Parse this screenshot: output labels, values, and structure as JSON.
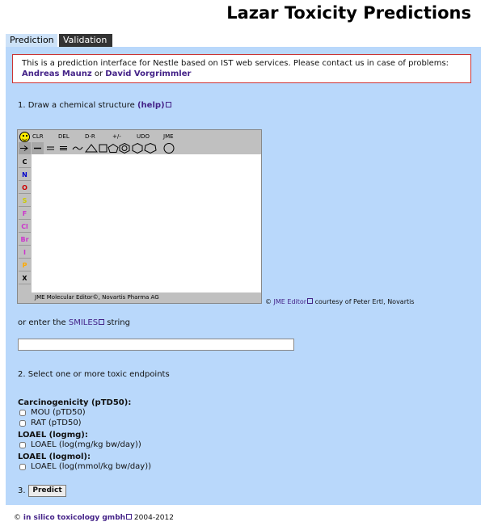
{
  "page_title": "Lazar Toxicity Predictions",
  "tabs": [
    {
      "label": "Prediction",
      "active": true
    },
    {
      "label": "Validation",
      "active": false
    }
  ],
  "info": {
    "text": "This is a prediction interface for Nestle based on IST web services. Please contact us in case of problems:",
    "contact1": "Andreas Maunz",
    "or": "or",
    "contact2": "David Vorgrimmler"
  },
  "step1": {
    "label": "1. Draw a chemical structure",
    "help": "(help)"
  },
  "editor": {
    "toolbar_top": [
      "CLR",
      "DEL",
      "D-R",
      "+/-",
      "UDO",
      "JME"
    ],
    "elements": [
      "C",
      "N",
      "O",
      "S",
      "F",
      "Cl",
      "Br",
      "I",
      "P",
      "X"
    ],
    "element_colors": [
      "#000000",
      "#0000cc",
      "#cc0000",
      "#cccc00",
      "#cc33cc",
      "#cc33cc",
      "#cc33cc",
      "#cc33cc",
      "#ffaa00",
      "#000000"
    ],
    "status": "JME Molecular Editor©, Novartis Pharma AG",
    "credit_prefix": "©",
    "credit_link": "JME Editor",
    "credit_suffix": "courtesy of Peter Ertl, Novartis"
  },
  "smiles": {
    "prefix": "or enter the",
    "link": "SMILES",
    "suffix": "string",
    "value": ""
  },
  "step2": {
    "label": "2. Select one or more toxic endpoints"
  },
  "endpoints": {
    "group1": {
      "title": "Carcinogenicity (pTD50):",
      "items": [
        "MOU (pTD50)",
        "RAT (pTD50)"
      ]
    },
    "group2": {
      "title": "LOAEL (logmg):",
      "items": [
        "LOAEL (log(mg/kg bw/day))"
      ]
    },
    "group3": {
      "title": "LOAEL (logmol):",
      "items": [
        "LOAEL (log(mmol/kg bw/day))"
      ]
    }
  },
  "step3": {
    "label": "3.",
    "button": "Predict"
  },
  "footer": {
    "prefix": "©",
    "link": "in silico toxicology gmbh",
    "years": "2004-2012"
  }
}
